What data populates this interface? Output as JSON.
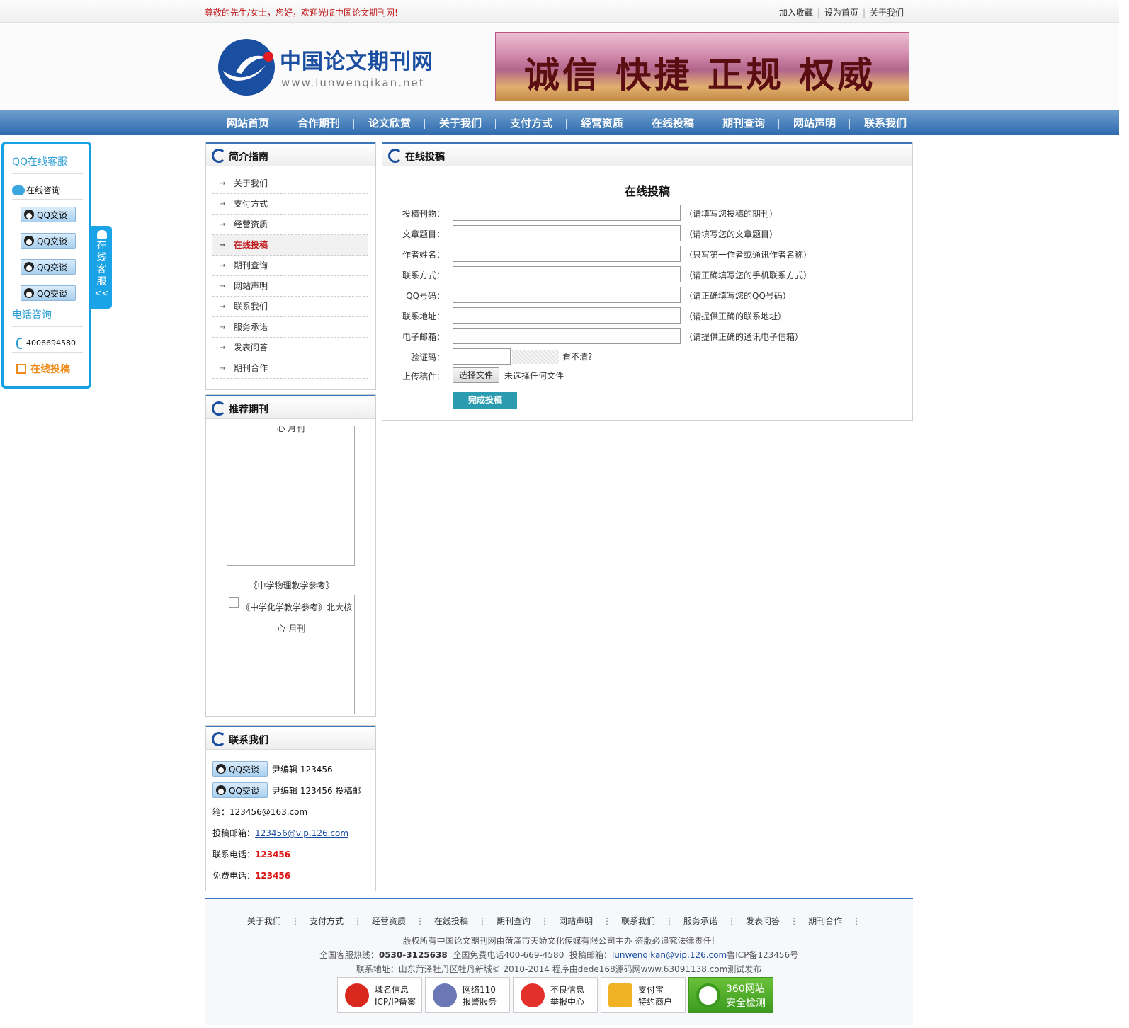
{
  "topbar": {
    "welcome": "尊敬的先生/女士，您好，欢迎光临中国论文期刊网!",
    "links": [
      "加入收藏",
      "设为首页",
      "关于我们"
    ]
  },
  "header": {
    "logo_title": "中国论文期刊网",
    "logo_url": "www.lunwenqikan.net",
    "banner_text": "诚信 快捷 正规 权威"
  },
  "nav": [
    "网站首页",
    "合作期刊",
    "论文欣赏",
    "关于我们",
    "支付方式",
    "经营资质",
    "在线投稿",
    "期刊查询",
    "网站声明",
    "联系我们"
  ],
  "float_service": {
    "qq_head": "QQ在线客服",
    "consult": "在线咨询",
    "qq_label": "QQ交谈",
    "phone_head": "电话咨询",
    "phone": "4006694580",
    "submit": "在线投稿",
    "tab_text": "在线客服",
    "tab_arrow": "<<"
  },
  "guide": {
    "title": "简介指南",
    "items": [
      "关于我们",
      "支付方式",
      "经营资质",
      "在线投稿",
      "期刊查询",
      "网站声明",
      "联系我们",
      "服务承诺",
      "发表问答",
      "期刊合作"
    ],
    "active_index": 3
  },
  "recommend": {
    "title": "推荐期刊",
    "item1_tail": "心 月刊",
    "item1_caption": "《中学物理教学参考》",
    "item2_alt_line1": "《中学化学教学参考》北大核",
    "item2_alt_line2": "心 月刊"
  },
  "contact": {
    "title": "联系我们",
    "qq_label": "QQ交谈",
    "line1": "尹编辑 123456",
    "line2": "尹编辑 123456 投稿邮",
    "line3": "箱：123456@163.com",
    "email_label": "投稿邮箱：",
    "email": "123456@vip.126.com",
    "tel_label": "联系电话：",
    "tel": "123456",
    "free_label": "免费电话：",
    "free": "123456"
  },
  "form": {
    "header": "在线投稿",
    "title": "在线投稿",
    "rows": [
      {
        "label": "投稿刊物：",
        "hint": "（请填写您投稿的期刊）"
      },
      {
        "label": "文章题目：",
        "hint": "（请填写您的文章题目）"
      },
      {
        "label": "作者姓名：",
        "hint": "（只写第一作者或通讯作者名称）"
      },
      {
        "label": "联系方式：",
        "hint": "（请正确填写您的手机联系方式）"
      },
      {
        "label": "QQ号码：",
        "hint": "（请正确填写您的QQ号码）"
      },
      {
        "label": "联系地址：",
        "hint": "（请提供正确的联系地址）"
      },
      {
        "label": "电子邮箱：",
        "hint": "（请提供正确的通讯电子信箱）"
      }
    ],
    "captcha_label": "验证码：",
    "captcha_hint": "看不清?",
    "upload_label": "上传稿件：",
    "upload_button": "选择文件",
    "upload_status": "未选择任何文件",
    "submit": "完成投稿"
  },
  "footer": {
    "links": [
      "关于我们",
      "支付方式",
      "经营资质",
      "在线投稿",
      "期刊查询",
      "网站声明",
      "联系我们",
      "服务承诺",
      "发表问答",
      "期刊合作"
    ],
    "line1": "版权所有中国论文期刊网由菏泽市天娇文化传媒有限公司主办 盗版必追究法律责任!",
    "line2_a": "全国客服热线：",
    "line2_b": "0530-3125638",
    "line2_c": "  全国免费电话400-669-4580  投稿邮箱：",
    "line2_d": "lunwenqikan@vip.126.com",
    "line2_e": "鲁ICP备123456号",
    "line3": "联系地址：山东菏泽牡丹区牡丹新城© 2010-2014 程序由dede168源码网www.63091138.com测试发布",
    "badges": [
      {
        "l1": "域名信息",
        "l2": "ICP/IP备案"
      },
      {
        "l1": "网络110",
        "l2": "报警服务"
      },
      {
        "l1": "不良信息",
        "l2": "举报中心"
      },
      {
        "l1": "支付宝",
        "l2": "特约商户"
      },
      {
        "l1": "360网站",
        "l2": "安全检测"
      }
    ]
  }
}
